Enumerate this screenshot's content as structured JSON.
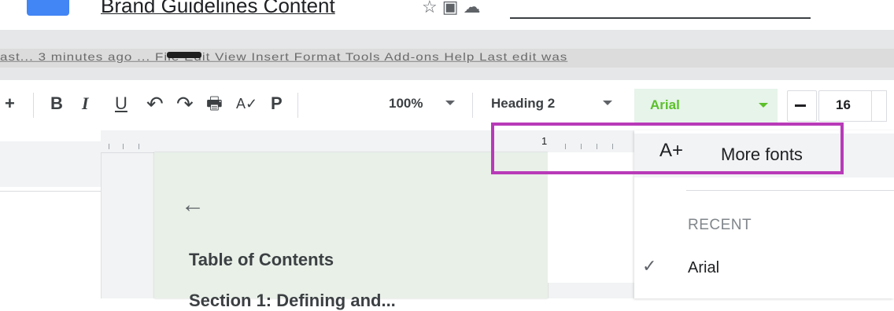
{
  "window": {
    "doc_title": "Brand Guidelines Content",
    "title_icons": [
      "star-icon",
      "move-to-folder-icon",
      "cloud-status-icon"
    ]
  },
  "menubar": {
    "text": "ast... 3 minutes ago ... File Edit View Insert Format Tools Add-ons Help Last edit was"
  },
  "toolbar": {
    "add_label": "+",
    "bold_label": "B",
    "italic_label": "I",
    "underline_label": "U",
    "undo_icon": "↶",
    "redo_icon": "↷",
    "print_icon": "🖶",
    "spellcheck_icon": "A✓",
    "paint_format_icon": "P",
    "zoom": "100%",
    "style": "Heading 2",
    "font": "Arial",
    "size_minus": "−",
    "font_size": "16",
    "colors": {
      "font_active": "#5cc02a",
      "font_bg": "#e6f4ea"
    }
  },
  "ruler": {
    "number": "1"
  },
  "document": {
    "back_arrow": "←",
    "toc_title": "Table of Contents",
    "toc_item": "Section 1: Defining and..."
  },
  "font_menu": {
    "more_icon": "A+",
    "more_fonts": "More fonts",
    "recent_header": "RECENT",
    "recent": [
      "Arial"
    ],
    "check_icon": "✓"
  },
  "annotation": {
    "color": "#b83ab8"
  }
}
